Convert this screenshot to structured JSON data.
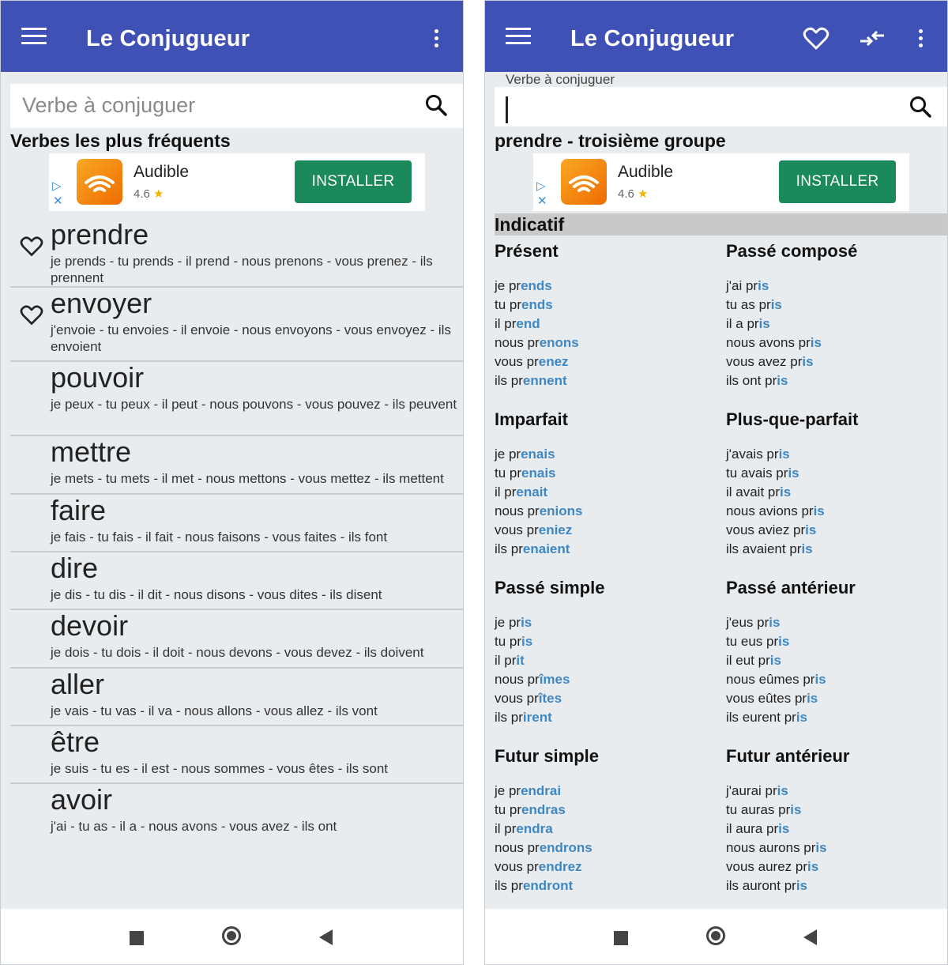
{
  "left_screen": {
    "app_title": "Le Conjugueur",
    "search": {
      "placeholder": "Verbe à conjuguer"
    },
    "section_title": "Verbes les plus fréquents",
    "ad": {
      "app_name": "Audible",
      "rating": "4.6",
      "button": "INSTALLER"
    },
    "verbs": [
      {
        "name": "prendre",
        "conj": "je prends - tu prends - il prend - nous prenons - vous prenez - ils prennent",
        "favorite_icon": true
      },
      {
        "name": "envoyer",
        "conj": "j'envoie - tu envoies - il envoie - nous envoyons - vous envoyez - ils envoient",
        "favorite_icon": true
      },
      {
        "name": "pouvoir",
        "conj": "je peux - tu peux - il peut - nous pouvons - vous pouvez - ils peuvent",
        "favorite_icon": false
      },
      {
        "name": "mettre",
        "conj": "je mets - tu mets - il met - nous mettons - vous mettez - ils mettent",
        "favorite_icon": false
      },
      {
        "name": "faire",
        "conj": "je fais - tu fais - il fait - nous faisons - vous faites - ils font",
        "favorite_icon": false
      },
      {
        "name": "dire",
        "conj": "je dis - tu dis - il dit - nous disons - vous dites - ils disent",
        "favorite_icon": false
      },
      {
        "name": "devoir",
        "conj": "je dois - tu dois - il doit - nous devons - vous devez - ils doivent",
        "favorite_icon": false
      },
      {
        "name": "aller",
        "conj": "je vais - tu vas - il va - nous allons - vous allez - ils vont",
        "favorite_icon": false
      },
      {
        "name": "être",
        "conj": "je suis - tu es - il est - nous sommes - vous êtes - ils sont",
        "favorite_icon": false
      },
      {
        "name": "avoir",
        "conj": "j'ai - tu as - il a - nous avons - vous avez - ils ont",
        "favorite_icon": false
      }
    ]
  },
  "right_screen": {
    "app_title": "Le Conjugueur",
    "search": {
      "label": "Verbe à conjuguer",
      "value": ""
    },
    "verb_heading": "prendre - troisième groupe",
    "ad": {
      "app_name": "Audible",
      "rating": "4.6",
      "button": "INSTALLER"
    },
    "mode": "Indicatif",
    "tenses": [
      {
        "name": "Présent",
        "lines": [
          [
            "je pr",
            "ends"
          ],
          [
            "tu pr",
            "ends"
          ],
          [
            "il pr",
            "end"
          ],
          [
            "nous pr",
            "enons"
          ],
          [
            "vous pr",
            "enez"
          ],
          [
            "ils pr",
            "ennent"
          ]
        ]
      },
      {
        "name": "Passé composé",
        "lines": [
          [
            "j'ai pr",
            "is"
          ],
          [
            "tu as pr",
            "is"
          ],
          [
            "il a pr",
            "is"
          ],
          [
            "nous avons pr",
            "is"
          ],
          [
            "vous avez pr",
            "is"
          ],
          [
            "ils ont pr",
            "is"
          ]
        ]
      },
      {
        "name": "Imparfait",
        "lines": [
          [
            "je pr",
            "enais"
          ],
          [
            "tu pr",
            "enais"
          ],
          [
            "il pr",
            "enait"
          ],
          [
            "nous pr",
            "enions"
          ],
          [
            "vous pr",
            "eniez"
          ],
          [
            "ils pr",
            "enaient"
          ]
        ]
      },
      {
        "name": "Plus-que-parfait",
        "lines": [
          [
            "j'avais pr",
            "is"
          ],
          [
            "tu avais pr",
            "is"
          ],
          [
            "il avait pr",
            "is"
          ],
          [
            "nous avions pr",
            "is"
          ],
          [
            "vous aviez pr",
            "is"
          ],
          [
            "ils avaient pr",
            "is"
          ]
        ]
      },
      {
        "name": "Passé simple",
        "lines": [
          [
            "je pr",
            "is"
          ],
          [
            "tu pr",
            "is"
          ],
          [
            "il pr",
            "it"
          ],
          [
            "nous pr",
            "îmes"
          ],
          [
            "vous pr",
            "îtes"
          ],
          [
            "ils pr",
            "irent"
          ]
        ]
      },
      {
        "name": "Passé antérieur",
        "lines": [
          [
            "j'eus pr",
            "is"
          ],
          [
            "tu eus pr",
            "is"
          ],
          [
            "il eut pr",
            "is"
          ],
          [
            "nous eûmes pr",
            "is"
          ],
          [
            "vous eûtes pr",
            "is"
          ],
          [
            "ils eurent pr",
            "is"
          ]
        ]
      },
      {
        "name": "Futur simple",
        "lines": [
          [
            "je pr",
            "endrai"
          ],
          [
            "tu pr",
            "endras"
          ],
          [
            "il pr",
            "endra"
          ],
          [
            "nous pr",
            "endrons"
          ],
          [
            "vous pr",
            "endrez"
          ],
          [
            "ils pr",
            "endront"
          ]
        ]
      },
      {
        "name": "Futur antérieur",
        "lines": [
          [
            "j'aurai pr",
            "is"
          ],
          [
            "tu auras pr",
            "is"
          ],
          [
            "il aura pr",
            "is"
          ],
          [
            "nous aurons pr",
            "is"
          ],
          [
            "vous aurez pr",
            "is"
          ],
          [
            "ils auront pr",
            "is"
          ]
        ]
      }
    ]
  },
  "colors": {
    "app_bar": "#3f51b5",
    "install_button": "#1b8a5a",
    "ending_highlight": "#3f87c3",
    "background": "#e9ecef"
  }
}
